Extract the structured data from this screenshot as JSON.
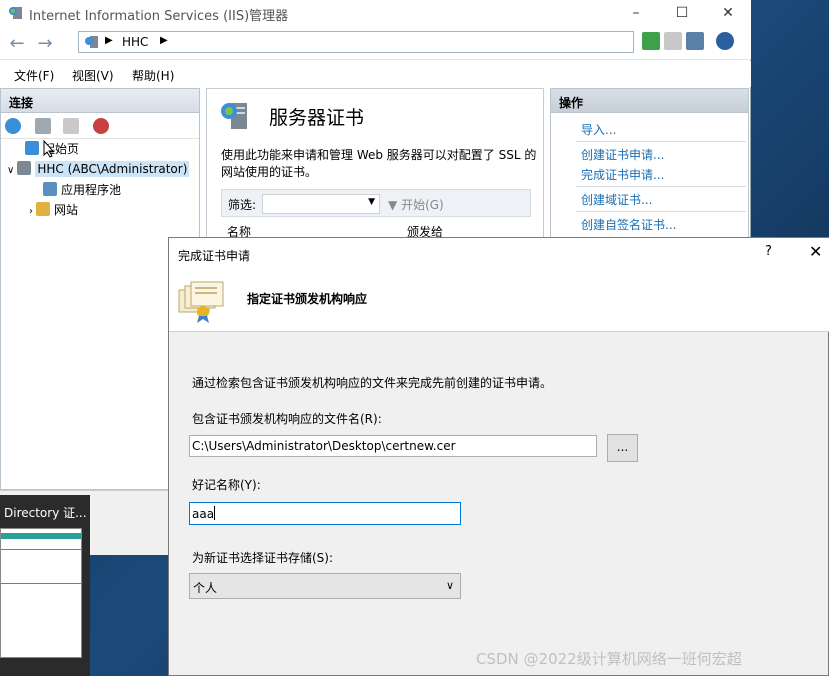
{
  "window": {
    "title": "Internet Information Services (IIS)管理器",
    "address_crumb": "HHC",
    "minimize": "–",
    "maximize": "☐",
    "close": "✕"
  },
  "menu": [
    "文件(F)",
    "视图(V)",
    "帮助(H)"
  ],
  "connections": {
    "header": "连接",
    "tree": [
      {
        "label": "起始页"
      },
      {
        "label": "HHC (ABC\\Administrator)"
      },
      {
        "label": "应用程序池"
      },
      {
        "label": "网站"
      }
    ]
  },
  "feature": {
    "title": "服务器证书",
    "description": "使用此功能来申请和管理 Web 服务器可以对配置了 SSL 的网站使用的证书。",
    "filter_label": "筛选:",
    "start_label": "开始(G)",
    "columns": [
      "名称",
      "颁发给"
    ]
  },
  "actions": {
    "header": "操作",
    "items": [
      "导入...",
      "创建证书申请...",
      "完成证书申请...",
      "创建域证书...",
      "创建自签名证书..."
    ]
  },
  "thumbnail": {
    "label": "Directory 证..."
  },
  "dialog": {
    "title": "完成证书申请",
    "help": "?",
    "close": "✕",
    "heading": "指定证书颁发机构响应",
    "description": "通过检索包含证书颁发机构响应的文件来完成先前创建的证书申请。",
    "file_label": "包含证书颁发机构响应的文件名(R):",
    "file_value": "C:\\Users\\Administrator\\Desktop\\certnew.cer",
    "browse": "...",
    "friendly_label": "好记名称(Y):",
    "friendly_value": "aaa",
    "store_label": "为新证书选择证书存储(S):",
    "store_value": "个人"
  },
  "watermark": "CSDN @2022级计算机网络一班何宏超",
  "colors": {
    "link": "#1a6fb5",
    "selected": "#cce4f7",
    "focus": "#0078d7"
  }
}
